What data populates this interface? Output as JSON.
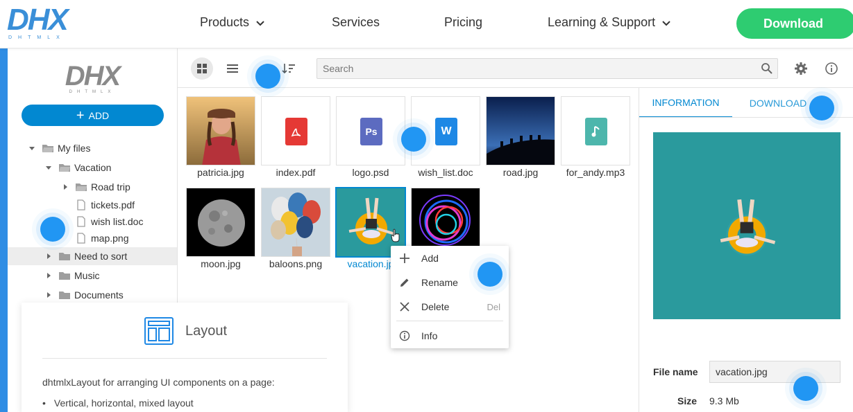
{
  "site": {
    "logo_text": "DHX",
    "logo_sub": "DHTMLX",
    "nav": [
      {
        "label": "Products",
        "has_dropdown": true
      },
      {
        "label": "Services",
        "has_dropdown": false
      },
      {
        "label": "Pricing",
        "has_dropdown": false
      },
      {
        "label": "Learning & Support",
        "has_dropdown": true
      }
    ],
    "download_label": "Download",
    "colors": {
      "brand_blue": "#3a8fd8",
      "download_green": "#2ecc71",
      "accent_blue": "#0288d1"
    }
  },
  "sidebar": {
    "logo_text": "DHX",
    "logo_sub": "DHTMLX",
    "add_label": "ADD",
    "tree": [
      {
        "label": "My files",
        "type": "folder",
        "expanded": true
      },
      {
        "label": "Vacation",
        "type": "folder",
        "expanded": true
      },
      {
        "label": "Road trip",
        "type": "folder",
        "expanded": false
      },
      {
        "label": "tickets.pdf",
        "type": "file"
      },
      {
        "label": "wish list.doc",
        "type": "file"
      },
      {
        "label": "map.png",
        "type": "file"
      },
      {
        "label": "Need to sort",
        "type": "folder",
        "expanded": false,
        "selected": true
      },
      {
        "label": "Music",
        "type": "folder",
        "expanded": false
      },
      {
        "label": "Documents",
        "type": "folder",
        "expanded": false
      }
    ]
  },
  "toolbar": {
    "search_placeholder": "Search",
    "view_mode": "grid"
  },
  "files": [
    {
      "name": "patricia.jpg",
      "kind": "photo"
    },
    {
      "name": "index.pdf",
      "kind": "pdf"
    },
    {
      "name": "logo.psd",
      "kind": "psd",
      "badge": "Ps"
    },
    {
      "name": "wish_list.doc",
      "kind": "doc",
      "badge": "W"
    },
    {
      "name": "road.jpg",
      "kind": "photo"
    },
    {
      "name": "for_andy.mp3",
      "kind": "audio"
    },
    {
      "name": "moon.jpg",
      "kind": "photo"
    },
    {
      "name": "baloons.png",
      "kind": "photo"
    },
    {
      "name": "vacation.jpg",
      "kind": "photo",
      "selected": true,
      "label_shown": "vacation.jp"
    },
    {
      "name": "",
      "kind": "photo"
    }
  ],
  "context_menu": {
    "items": [
      {
        "label": "Add",
        "icon": "plus-icon",
        "hotkey": ""
      },
      {
        "label": "Rename",
        "icon": "pencil-icon",
        "hotkey": ""
      },
      {
        "label": "Delete",
        "icon": "close-icon",
        "hotkey": "Del"
      },
      {
        "label": "Info",
        "icon": "info-icon",
        "hotkey": ""
      }
    ]
  },
  "info_panel": {
    "tabs": [
      {
        "label": "INFORMATION",
        "active": true
      },
      {
        "label": "DOWNLOAD",
        "active": false
      }
    ],
    "file_name_label": "File name",
    "file_name_value": "vacation.jpg",
    "size_label": "Size",
    "size_value": "9.3 Mb"
  },
  "layout_card": {
    "title": "Layout",
    "description": "dhtmlxLayout for arranging UI components on a page:",
    "bullets": [
      "Vertical, horizontal, mixed layout"
    ]
  }
}
